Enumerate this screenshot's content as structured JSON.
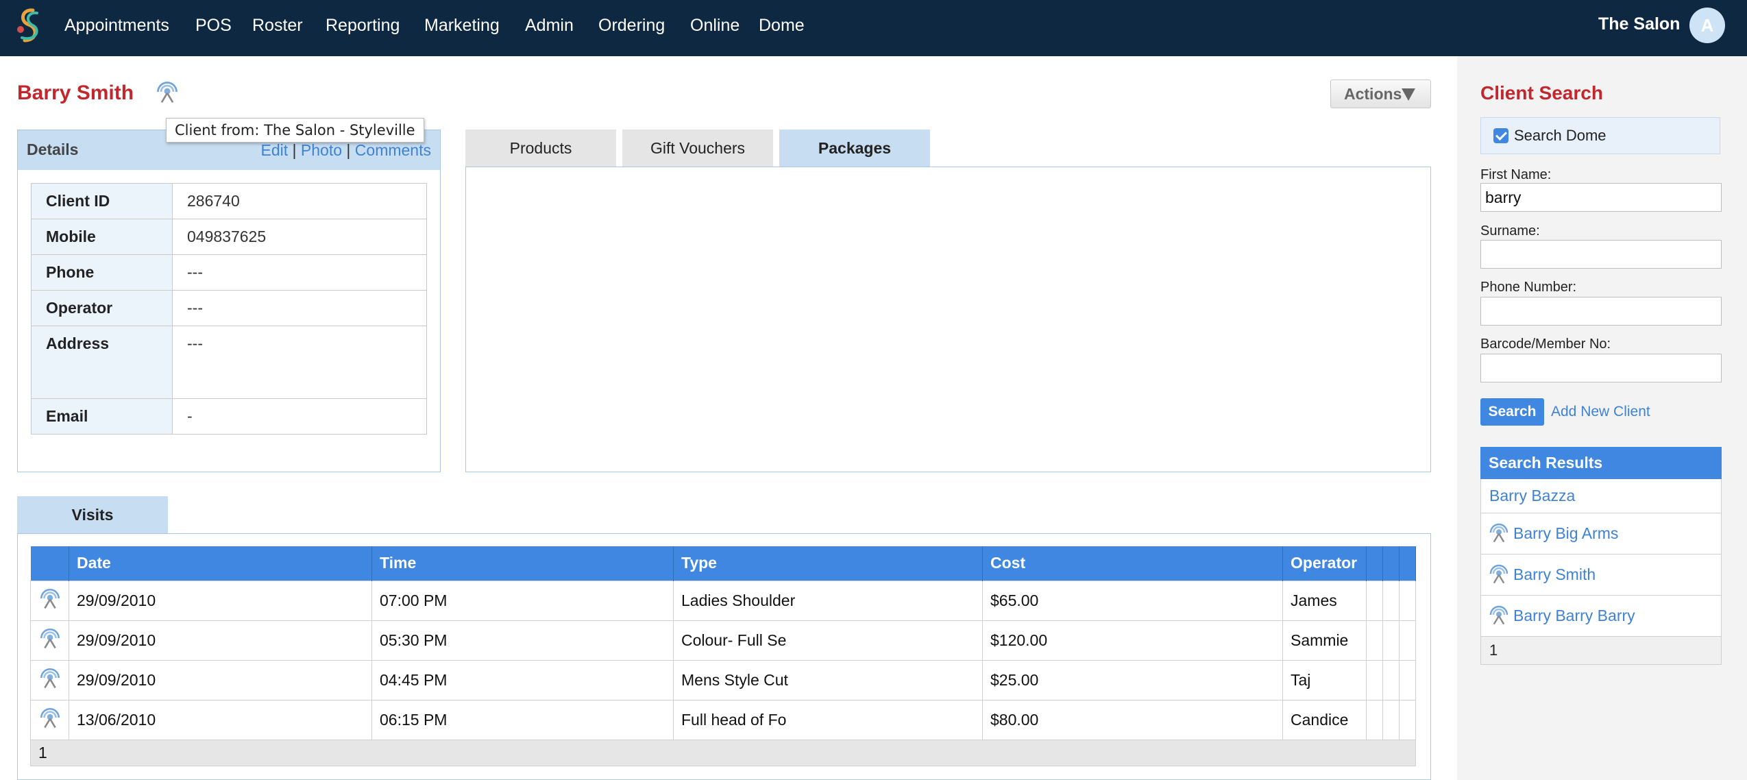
{
  "nav": {
    "items": [
      "Appointments",
      "POS",
      "Roster",
      "Reporting",
      "Marketing",
      "Admin",
      "Ordering",
      "Online",
      "Dome"
    ],
    "salon": "The Salon",
    "avatar_initial": "A"
  },
  "client": {
    "name": "Barry Smith",
    "tooltip": "Client from: The Salon - Styleville",
    "actions_label": "Actions"
  },
  "details": {
    "title": "Details",
    "links": {
      "edit": "Edit",
      "photo": "Photo",
      "comments": "Comments",
      "separator": "|"
    },
    "rows": [
      {
        "label": "Client ID",
        "value": "286740"
      },
      {
        "label": "Mobile",
        "value": "049837625"
      },
      {
        "label": "Phone",
        "value": "---"
      },
      {
        "label": "Operator",
        "value": "---"
      },
      {
        "label": "Address",
        "value": "---"
      },
      {
        "label": "Email",
        "value": "-"
      }
    ]
  },
  "tabs": {
    "products": "Products",
    "gift_vouchers": "Gift Vouchers",
    "packages": "Packages",
    "active": "Packages"
  },
  "visits": {
    "tab": "Visits",
    "columns": [
      "Date",
      "Time",
      "Type",
      "Cost",
      "Operator"
    ],
    "rows": [
      {
        "date": "29/09/2010",
        "time": "07:00 PM",
        "type": "Ladies Shoulder",
        "cost": "$65.00",
        "operator": "James"
      },
      {
        "date": "29/09/2010",
        "time": "05:30 PM",
        "type": "Colour- Full Se",
        "cost": "$120.00",
        "operator": "Sammie"
      },
      {
        "date": "29/09/2010",
        "time": "04:45 PM",
        "type": "Mens Style Cut",
        "cost": "$25.00",
        "operator": "Taj"
      },
      {
        "date": "13/06/2010",
        "time": "06:15 PM",
        "type": "Full head of Fo",
        "cost": "$80.00",
        "operator": "Candice"
      }
    ],
    "page": "1"
  },
  "search": {
    "title": "Client Search",
    "dome_label": "Search Dome",
    "dome_checked": true,
    "first_name_label": "First Name:",
    "first_name_value": "barry",
    "surname_label": "Surname:",
    "surname_value": "",
    "phone_label": "Phone Number:",
    "phone_value": "",
    "barcode_label": "Barcode/Member No:",
    "barcode_value": "",
    "search_button": "Search",
    "add_new": "Add New Client"
  },
  "results": {
    "title": "Search Results",
    "items": [
      {
        "name": "Barry Bazza",
        "icon": ""
      },
      {
        "name": "Barry Big Arms",
        "icon": "dome-icon"
      },
      {
        "name": "Barry Smith",
        "icon": "dome-icon"
      },
      {
        "name": "Barry Barry Barry",
        "icon": "dome-icon"
      }
    ],
    "page": "1"
  },
  "colors": {
    "nav_bg": "#0f2841",
    "accent_blue": "#3f87e0",
    "title_red": "#c1272d",
    "panel_blue": "#c7ddf1"
  }
}
